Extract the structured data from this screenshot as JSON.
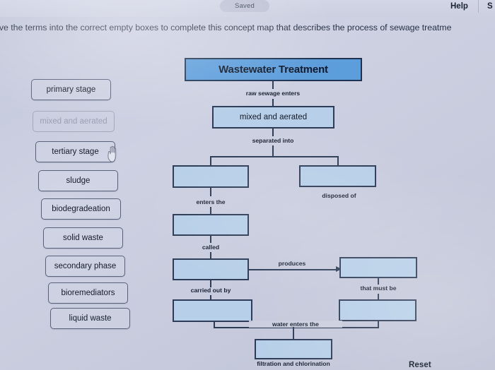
{
  "topbar": {
    "saved_label": "Saved",
    "help_label": "Help",
    "submit_label": "S"
  },
  "instruction": {
    "text": "ove the terms into the correct empty boxes to complete this concept map that describes the process of sewage treatme"
  },
  "term_bank": {
    "terms": [
      {
        "label": "primary stage",
        "used": false
      },
      {
        "label": "mixed and aerated",
        "used": true
      },
      {
        "label": "tertiary stage",
        "used": false
      },
      {
        "label": "sludge",
        "used": false
      },
      {
        "label": "biodegradeation",
        "used": false
      },
      {
        "label": "solid waste",
        "used": false
      },
      {
        "label": "secondary phase",
        "used": false
      },
      {
        "label": "bioremediators",
        "used": false
      },
      {
        "label": "liquid waste",
        "used": false
      }
    ]
  },
  "concept_map": {
    "title_node": "Wastewater Treatment",
    "nodes": [
      {
        "id": "n-mixed",
        "label": "mixed and aerated",
        "empty": false
      },
      {
        "id": "n-left1",
        "label": "",
        "empty": true
      },
      {
        "id": "n-right1",
        "label": "",
        "empty": true
      },
      {
        "id": "n-left2",
        "label": "",
        "empty": true
      },
      {
        "id": "n-left3",
        "label": "",
        "empty": true
      },
      {
        "id": "n-right2",
        "label": "",
        "empty": true
      },
      {
        "id": "n-left4",
        "label": "",
        "empty": true
      },
      {
        "id": "n-right3",
        "label": "",
        "empty": true
      },
      {
        "id": "n-bottom",
        "label": "",
        "empty": true
      }
    ],
    "connector_labels": {
      "raw_sewage": "raw sewage enters",
      "separated_into": "separated into",
      "enters_the": "enters the",
      "disposed_of": "disposed of",
      "called": "called",
      "produces": "produces",
      "carried_out_by": "carried out by",
      "that_must_be": "that must be",
      "water_enters_the": "water enters the",
      "filtration": "filtration and chlorination"
    }
  },
  "footer": {
    "reset_label": "Reset"
  },
  "colors": {
    "title_node_fill": "#5c9ddb",
    "node_fill": "#b7cfe8",
    "node_border": "#2d3c56",
    "page_background": "#c8ccdd"
  }
}
